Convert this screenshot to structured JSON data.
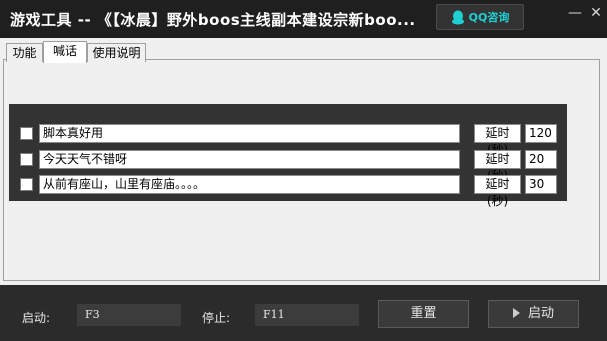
{
  "window": {
    "title": "游戏工具 -- 《【冰晨】野外boos主线副本建设宗新boo...",
    "qq_button": "QQ咨询",
    "minimize": "—",
    "close": "✕"
  },
  "tabs": [
    {
      "label": "功能"
    },
    {
      "label": "喊话"
    },
    {
      "label": "使用说明"
    }
  ],
  "active_tab": "喊话",
  "messages": [
    {
      "checked": false,
      "text": "脚本真好用",
      "delay_label": "延时(秒)",
      "delay": "120"
    },
    {
      "checked": false,
      "text": "今天天气不错呀",
      "delay_label": "延时(秒)",
      "delay": "20"
    },
    {
      "checked": false,
      "text": "从前有座山，山里有座庙。。。。",
      "delay_label": "延时(秒)",
      "delay": "30"
    }
  ],
  "bottom": {
    "start_label": "启动:",
    "start_hotkey": "F3",
    "stop_label": "停止:",
    "stop_hotkey": "F11",
    "reset_button": "重置",
    "launch_button": "启动"
  },
  "colors": {
    "accent": "#1fd0d3",
    "titlebar": "#1f1f1f",
    "dark_bg": "#2b2b2b",
    "panel_bg": "#f0f0f0"
  },
  "icons": {
    "qq": "qq-penguin-icon",
    "launch": "play-icon"
  }
}
